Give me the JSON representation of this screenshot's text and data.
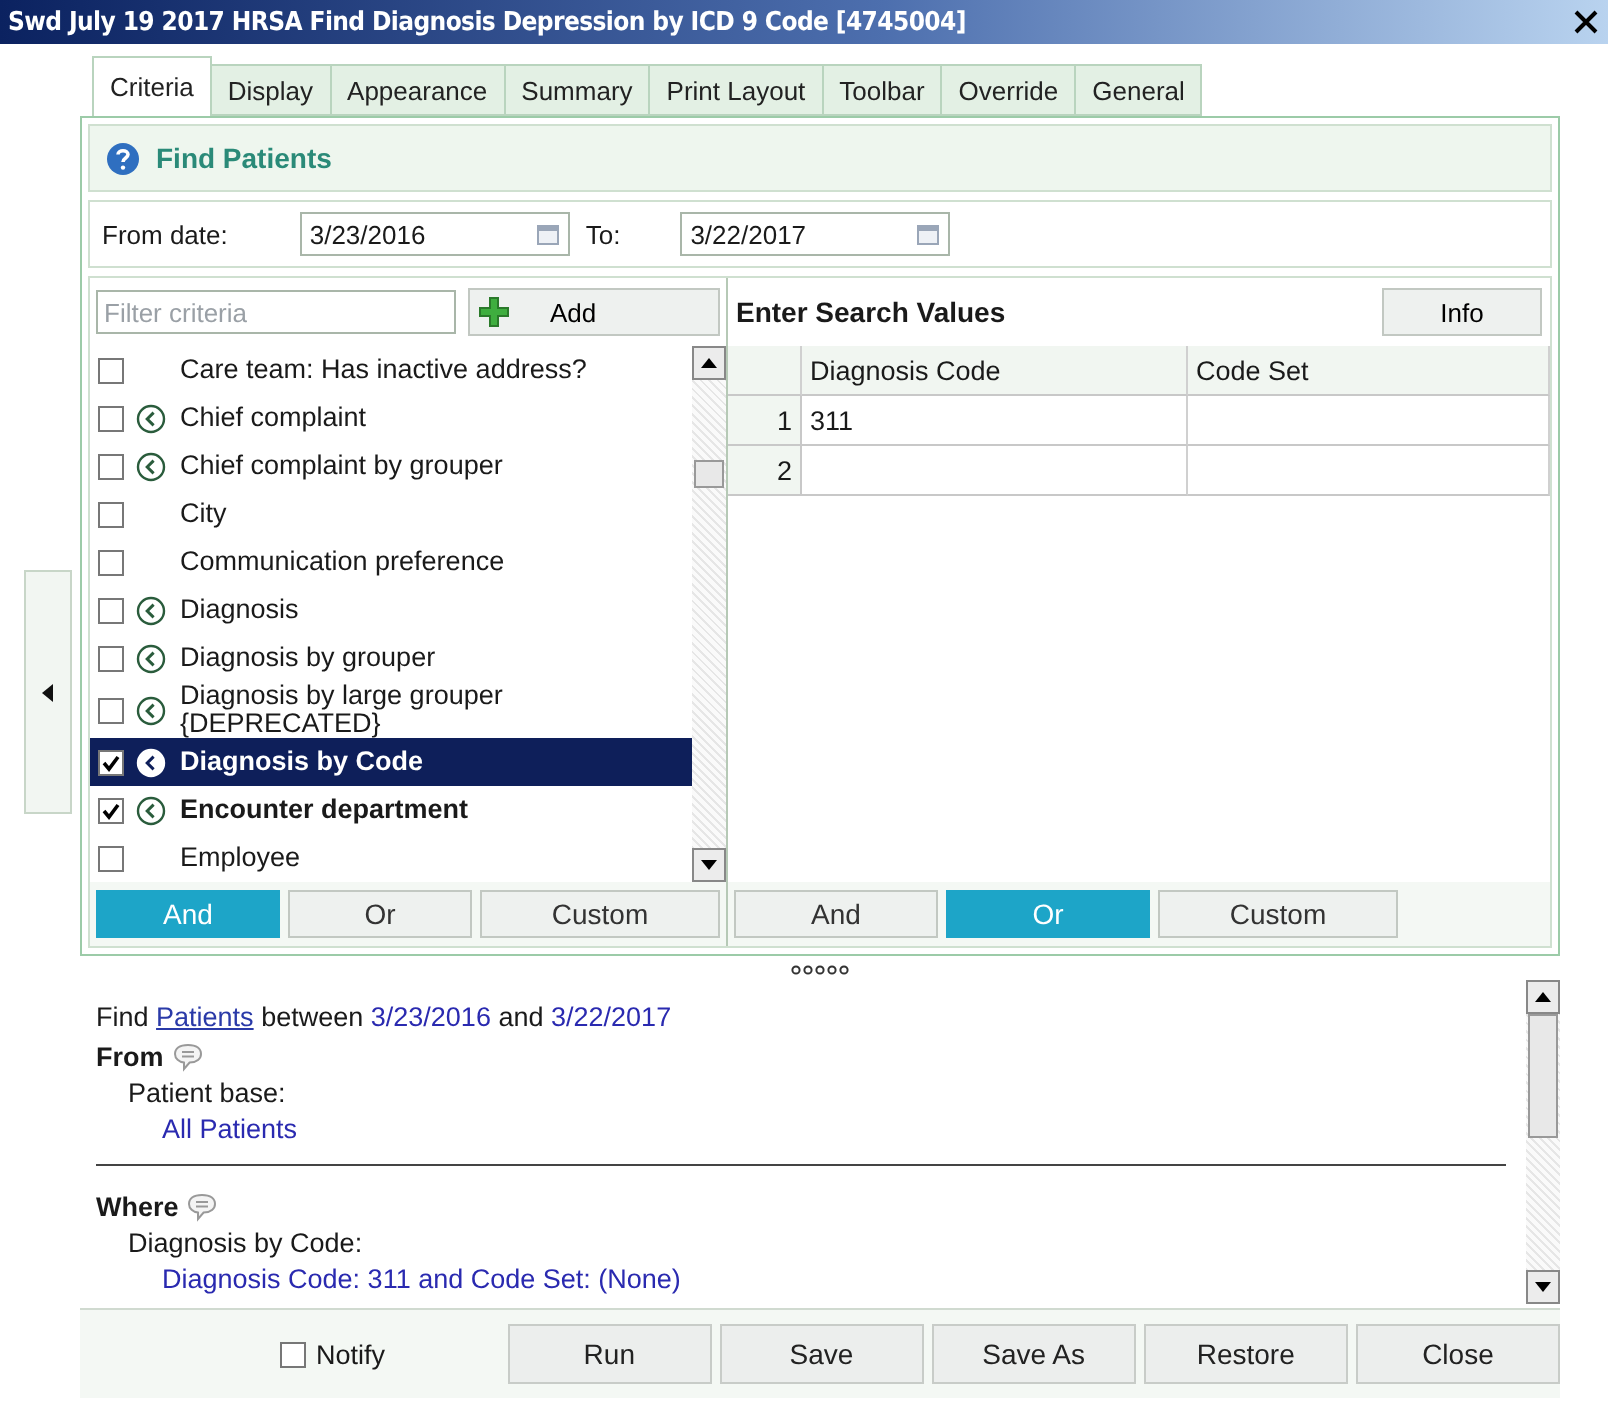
{
  "window": {
    "title": "Swd July 19 2017 HRSA Find Diagnosis Depression by ICD 9 Code [4745004]"
  },
  "tabs": [
    {
      "label": "Criteria",
      "selected": true
    },
    {
      "label": "Display",
      "selected": false
    },
    {
      "label": "Appearance",
      "selected": false
    },
    {
      "label": "Summary",
      "selected": false
    },
    {
      "label": "Print Layout",
      "selected": false
    },
    {
      "label": "Toolbar",
      "selected": false
    },
    {
      "label": "Override",
      "selected": false
    },
    {
      "label": "General",
      "selected": false
    }
  ],
  "header": {
    "title": "Find Patients"
  },
  "date_range": {
    "from_label": "From date:",
    "from": "3/23/2016",
    "to_label": "To:",
    "to": "3/22/2017"
  },
  "criteria": {
    "filter_placeholder": "Filter criteria",
    "add_button": "Add",
    "items": [
      {
        "label": "Care team: Has inactive address?",
        "checked": false,
        "grouper": false,
        "selected": false
      },
      {
        "label": "Chief complaint",
        "checked": false,
        "grouper": true,
        "selected": false
      },
      {
        "label": "Chief complaint by grouper",
        "checked": false,
        "grouper": true,
        "selected": false
      },
      {
        "label": "City",
        "checked": false,
        "grouper": false,
        "selected": false
      },
      {
        "label": "Communication preference",
        "checked": false,
        "grouper": false,
        "selected": false
      },
      {
        "label": "Diagnosis",
        "checked": false,
        "grouper": true,
        "selected": false
      },
      {
        "label": "Diagnosis by grouper",
        "checked": false,
        "grouper": true,
        "selected": false
      },
      {
        "label": "Diagnosis by large grouper {DEPRECATED}",
        "checked": false,
        "grouper": true,
        "selected": false
      },
      {
        "label": "Diagnosis by Code",
        "checked": true,
        "grouper": true,
        "selected": true
      },
      {
        "label": "Encounter department",
        "checked": true,
        "grouper": true,
        "selected": false
      },
      {
        "label": "Employee",
        "checked": false,
        "grouper": false,
        "selected": false
      }
    ],
    "logic": [
      {
        "label": "And",
        "selected": true
      },
      {
        "label": "Or",
        "selected": false
      },
      {
        "label": "Custom",
        "selected": false
      }
    ]
  },
  "search_values": {
    "title": "Enter Search Values",
    "info_button": "Info",
    "columns": [
      "Diagnosis Code",
      "Code Set"
    ],
    "rows": [
      {
        "number": "1",
        "diagnosis_code": "311"
      },
      {
        "number": "2"
      }
    ],
    "logic": [
      {
        "label": "And",
        "selected": false
      },
      {
        "label": "Or",
        "selected": true
      },
      {
        "label": "Custom",
        "selected": false
      }
    ]
  },
  "summary": {
    "find": "Find",
    "entity": "Patients",
    "between": "between",
    "from": "3/23/2016",
    "and": "and",
    "to": "3/22/2017",
    "sections": [
      {
        "heading": "From",
        "label": "Patient base:",
        "value": "All Patients"
      },
      {
        "heading": "Where",
        "label": "Diagnosis by Code:",
        "value": "Diagnosis Code: 311 and Code Set: (None)"
      }
    ]
  },
  "footer": {
    "notify": {
      "label": "Notify",
      "checked": false
    },
    "buttons": [
      "Run",
      "Save",
      "Save As",
      "Restore",
      "Close"
    ]
  }
}
